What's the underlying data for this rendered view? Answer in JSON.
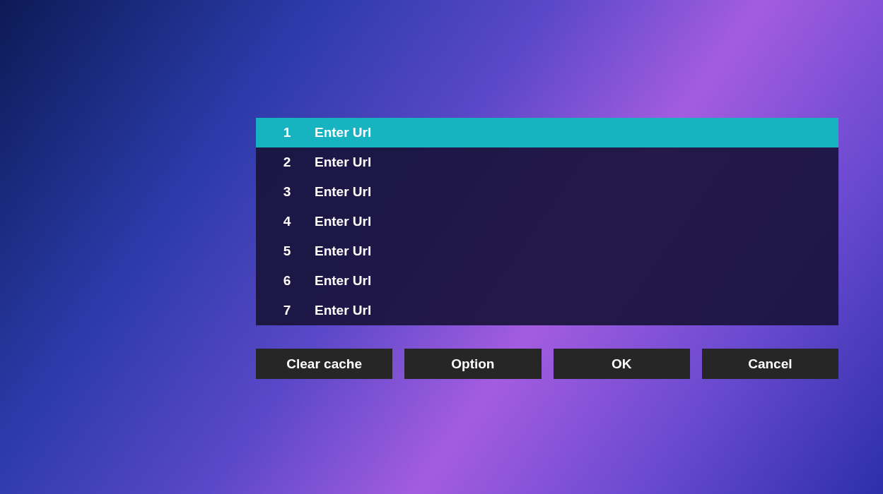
{
  "url_list": [
    {
      "number": "1",
      "label": "Enter Url",
      "selected": true
    },
    {
      "number": "2",
      "label": "Enter Url",
      "selected": false
    },
    {
      "number": "3",
      "label": "Enter Url",
      "selected": false
    },
    {
      "number": "4",
      "label": "Enter Url",
      "selected": false
    },
    {
      "number": "5",
      "label": "Enter Url",
      "selected": false
    },
    {
      "number": "6",
      "label": "Enter Url",
      "selected": false
    },
    {
      "number": "7",
      "label": "Enter Url",
      "selected": false
    }
  ],
  "buttons": [
    "Clear cache",
    "Option",
    "OK",
    "Cancel"
  ]
}
